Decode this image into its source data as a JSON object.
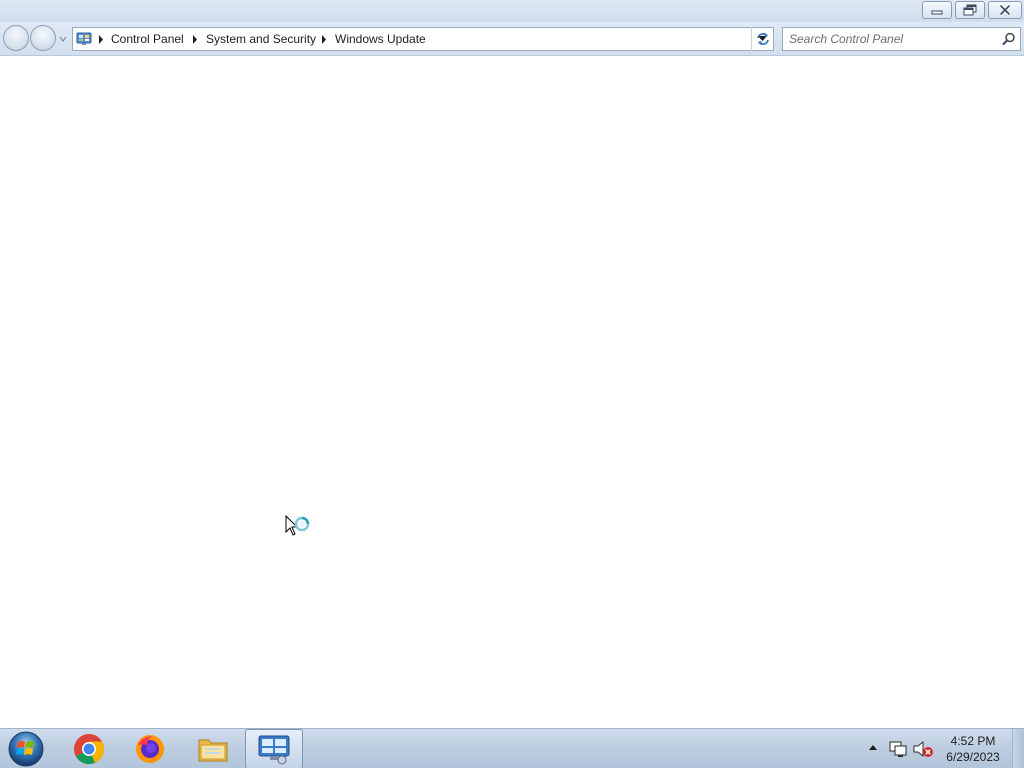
{
  "window": {
    "controls": {
      "minimize_icon": "minimize-icon",
      "restore_icon": "restore-icon",
      "close_icon": "close-icon"
    }
  },
  "navigation": {
    "breadcrumbs": [
      "Control Panel",
      "System and Security",
      "Windows Update"
    ],
    "search": {
      "placeholder": "Search Control Panel",
      "value": ""
    }
  },
  "content": {
    "cursor": "busy-cursor"
  },
  "taskbar": {
    "pinned": [
      {
        "name": "Google Chrome",
        "icon": "chrome-icon"
      },
      {
        "name": "Firefox",
        "icon": "firefox-icon"
      },
      {
        "name": "Windows Explorer",
        "icon": "explorer-icon"
      },
      {
        "name": "Control Panel",
        "icon": "control-panel-icon",
        "active": true
      }
    ],
    "clock": {
      "time": "4:52 PM",
      "date": "6/29/2023"
    }
  },
  "colors": {
    "chrome_background": "#dfe9f5",
    "taskbar": "#bccddf",
    "content_background": "#ffffff"
  }
}
